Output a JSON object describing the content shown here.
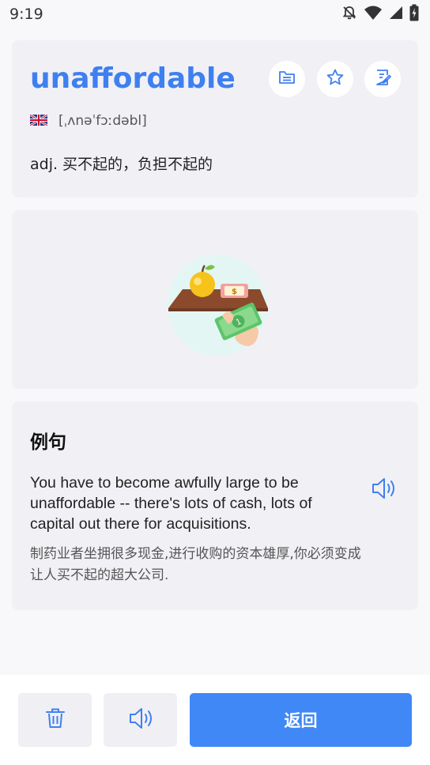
{
  "status_bar": {
    "time": "9:19",
    "icons": [
      "bell-off-icon",
      "wifi-icon",
      "signal-icon",
      "battery-icon"
    ]
  },
  "word_card": {
    "word": "unaffordable",
    "actions": [
      "folder-icon",
      "star-icon",
      "note-edit-icon"
    ],
    "flag": "uk-flag-icon",
    "phonetic": "[ˌʌnəˈfɔːdəbl]",
    "definition": "adj. 买不起的，负担不起的"
  },
  "illustration": {
    "price_tag": "$"
  },
  "example": {
    "heading": "例句",
    "sentence_en": "You have to become awfully large to be unaffordable -- there's lots of cash, lots of capital out there for acquisitions.",
    "sentence_zh": "制药业者坐拥很多现金,进行收购的资本雄厚,你必须变成让人买不起的超大公司."
  },
  "bottom_bar": {
    "back_label": "返回"
  },
  "colors": {
    "accent": "#3f80f0",
    "button_primary": "#3f88f6",
    "card_bg": "#f1f1f5"
  }
}
